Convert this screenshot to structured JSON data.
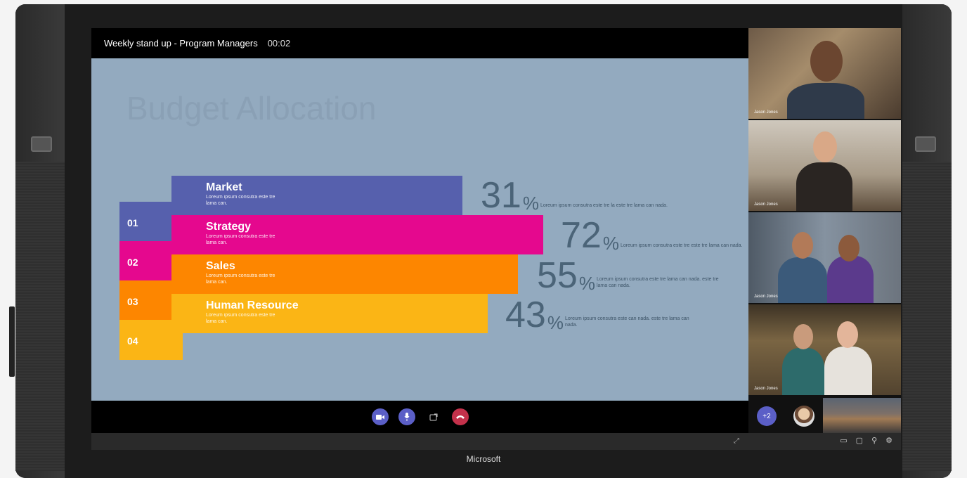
{
  "meeting": {
    "title": "Weekly stand up - Program Managers",
    "elapsed": "00:02"
  },
  "slide": {
    "title": "Budget Allocation",
    "items": [
      {
        "index": "01",
        "name": "Market",
        "desc": "Loreum ipsum consutra este tre lama can.",
        "value": "31",
        "pct": "%",
        "note": "Loreum ipsum consutra este tre la este tre lama can nada.",
        "color": "#5660ad"
      },
      {
        "index": "02",
        "name": "Strategy",
        "desc": "Loreum ipsum consutra este tre lama can.",
        "value": "72",
        "pct": "%",
        "note": "Loreum ipsum consutra este tre este tre lama can nada.",
        "color": "#e5088e"
      },
      {
        "index": "03",
        "name": "Sales",
        "desc": "Loreum ipsum consutra este tre lama can.",
        "value": "55",
        "pct": "%",
        "note": "Loreum ipsum consutra este tre lama can nada. este tre lama can nada.",
        "color": "#fd8600"
      },
      {
        "index": "04",
        "name": "Human Resource",
        "desc": "Loreum ipsum consutra este tre lama can.",
        "value": "43",
        "pct": "%",
        "note": "Loreum ipsum consutra este can nada. este tre lama can nada.",
        "color": "#fbb515"
      }
    ]
  },
  "participants": [
    {
      "name": "Jason Jones"
    },
    {
      "name": "Jason Jones"
    },
    {
      "name": "Jason Jones"
    },
    {
      "name": "Jason Jones"
    }
  ],
  "roster": {
    "more_count": "+2"
  },
  "controls": {
    "camera_icon": "video-camera-icon",
    "mic_icon": "microphone-icon",
    "share_icon": "share-screen-icon",
    "hangup_icon": "hang-up-icon"
  },
  "device": {
    "brand": "Microsoft"
  }
}
